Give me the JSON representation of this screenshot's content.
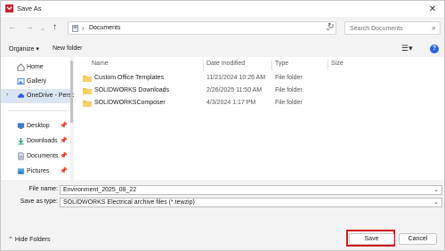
{
  "window": {
    "title": "Save As",
    "close_glyph": "✕"
  },
  "address": {
    "path": "Documents",
    "search_placeholder": "Search Documents",
    "nav_icons": [
      "back-arrow-icon",
      "forward-arrow-icon",
      "recent-chevron-icon",
      "up-arrow-icon"
    ]
  },
  "toolbar": {
    "organize_label": "Organize ▾",
    "new_folder_label": "New folder",
    "view_glyph": "☰▾",
    "help_glyph": "?"
  },
  "nav": {
    "items": [
      {
        "label": "Home",
        "icon": "home-icon"
      },
      {
        "label": "Gallery",
        "icon": "gallery-icon"
      },
      {
        "label": "OneDrive - Perso",
        "icon": "onedrive-cloud-icon",
        "selected": true
      },
      {
        "label": "Desktop",
        "icon": "desktop-icon",
        "pinned": true
      },
      {
        "label": "Downloads",
        "icon": "downloads-icon",
        "pinned": true
      },
      {
        "label": "Documents",
        "icon": "documents-icon",
        "pinned": true
      },
      {
        "label": "Pictures",
        "icon": "pictures-icon",
        "pinned": true
      }
    ]
  },
  "files": {
    "columns": {
      "name": "Name",
      "date": "Date modified",
      "type": "Type",
      "size": "Size"
    },
    "rows": [
      {
        "name": "Custom Office Templates",
        "date": "11/21/2024 10:26 AM",
        "type": "File folder"
      },
      {
        "name": "SOLIDWORKS Downloads",
        "date": "2/26/2025 11:50 AM",
        "type": "File folder"
      },
      {
        "name": "SOLIDWORKSComposer",
        "date": "4/3/2024 1:17 PM",
        "type": "File folder"
      }
    ]
  },
  "form": {
    "file_name_label": "File name:",
    "file_name_value": "Environment_2025_08_22",
    "save_type_label": "Save as type:",
    "save_type_value": "SOLIDWORKS Electrical archive files (*.tewzip)"
  },
  "footer": {
    "hide_folders_label": "Hide Folders",
    "save_label": "Save",
    "cancel_label": "Cancel"
  },
  "colors": {
    "accent": "#2b63d9",
    "highlight": "#d0181f",
    "folder": "#f3c14d",
    "selection": "#dbe4f2"
  }
}
